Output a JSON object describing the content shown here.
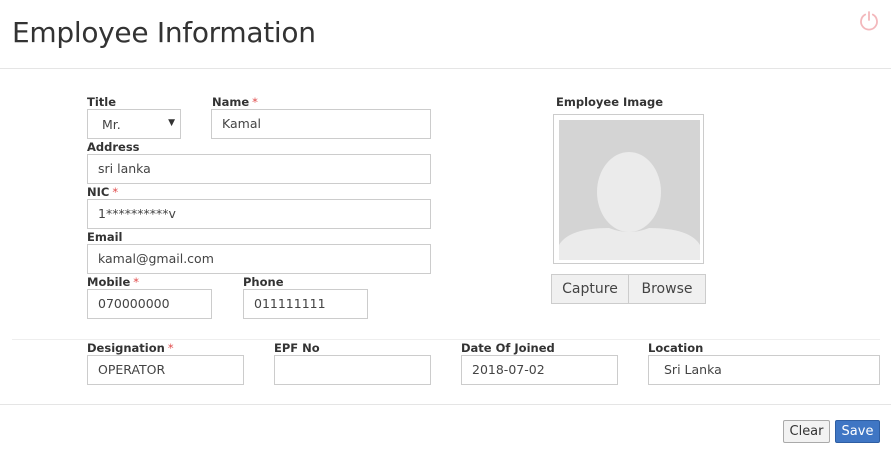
{
  "header": {
    "title": "Employee Information"
  },
  "form": {
    "title_label": "Title",
    "title_value": "Mr.",
    "name_label": "Name",
    "name_value": "Kamal",
    "address_label": "Address",
    "address_value": "sri lanka",
    "nic_label": "NIC",
    "nic_value": "1**********v",
    "email_label": "Email",
    "email_value": "kamal@gmail.com",
    "mobile_label": "Mobile",
    "mobile_value": "070000000",
    "phone_label": "Phone",
    "phone_value": "011111111",
    "designation_label": "Designation",
    "designation_value": "OPERATOR",
    "epf_label": "EPF No",
    "epf_value": "",
    "date_joined_label": "Date Of Joined",
    "date_joined_value": "2018-07-02",
    "location_label": "Location",
    "location_value": "Sri Lanka",
    "required_mark": "*"
  },
  "image_panel": {
    "label": "Employee Image",
    "capture_label": "Capture",
    "browse_label": "Browse"
  },
  "footer": {
    "clear_label": "Clear",
    "save_label": "Save"
  },
  "colors": {
    "required": "#e04b4b",
    "save_button": "#3f76c4",
    "power_icon": "#f3b8bc",
    "avatar_bg": "#d4d4d4"
  },
  "icons": {
    "power": "power-icon",
    "caret": "chevron-down-icon",
    "avatar": "avatar-placeholder-icon"
  }
}
